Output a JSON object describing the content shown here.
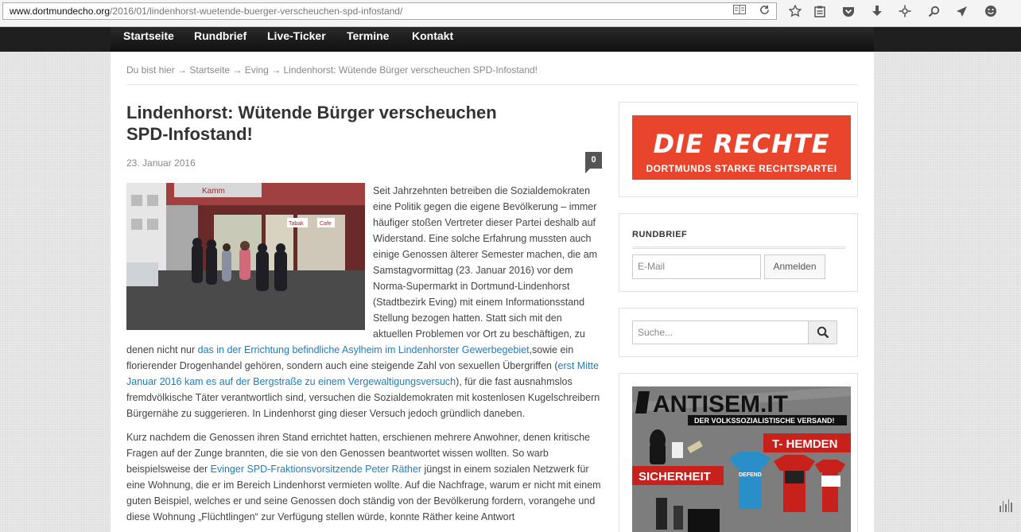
{
  "browser": {
    "url_domain": "www.dortmundecho.org",
    "url_path": "/2016/01/lindenhorst-wuetende-buerger-verscheuchen-spd-infostand/",
    "icons": [
      "reader-view-icon",
      "reload-icon",
      "bookmark-star-icon",
      "reading-list-icon",
      "pocket-icon",
      "download-icon",
      "extension-icon",
      "search-icon",
      "send-icon",
      "smiley-icon"
    ]
  },
  "nav": {
    "items": [
      "Startseite",
      "Rundbrief",
      "Live-Ticker",
      "Termine",
      "Kontakt"
    ]
  },
  "breadcrumb": {
    "prefix": "Du bist hier",
    "sep": "→",
    "items": [
      "Startseite",
      "Eving",
      "Lindenhorst: Wütende Bürger verscheuchen SPD-Infostand!"
    ]
  },
  "article": {
    "title": "Lindenhorst: Wütende Bürger verscheuchen SPD-Infostand!",
    "date": "23. Januar 2016",
    "comments": "0",
    "p1_a": "Seit Jahrzehnten betreiben die Sozialdemokraten eine Politik gegen die eigene Bevölkerung – immer häufiger stoßen Vertreter dieser Partei deshalb auf Widerstand. Eine solche Erfahrung mussten auch einige Genossen älterer Semester machen, die am Samstagvormittag (23. Januar 2016) vor dem Norma-Supermarkt in Dortmund-Lindenhorst (Stadtbezirk Eving) mit einem Informationsstand Stellung bezogen hatten. Statt sich mit den aktuellen Problemen vor Ort zu beschäftigen, zu denen nicht nur ",
    "p1_link1": "das in der Errichtung befindliche Asylheim im Lindenhorster Gewerbegebiet",
    "p1_b": ",sowie ein florierender Drogenhandel gehören, sondern auch eine steigende Zahl von sexuellen Übergriffen (",
    "p1_link2": "erst Mitte Januar 2016 kam es auf der Bergstraße zu einem Vergewaltigungsversuch",
    "p1_c": "), für die fast ausnahmslos fremdvölkische Täter verantwortlich sind, versuchen die Sozialdemokraten mit kostenlosen Kugelschreibern Bürgernähe zu suggerieren. In Lindenhorst ging dieser Versuch jedoch gründlich daneben.",
    "p2_a": "Kurz nachdem die Genossen ihren Stand errichtet hatten, erschienen mehrere Anwohner, denen kritische Fragen auf der Zunge brannten, die sie von den Genossen beantwortet wissen wollten. So warb beispielsweise der ",
    "p2_link": "Evinger SPD-Fraktionsvorsitzende Peter Räther",
    "p2_b": " jüngst in einem sozialen Netzwerk für eine Wohnung, die er im Bereich Lindenhorst vermieten wollte. Auf die Nachfrage, warum er nicht mit einem guten Beispiel, welches er und seine Genossen doch ständig von der Bevölkerung fordern, vorangehe und diese Wohnung „Flüchtlingen“ zur Verfügung stellen würde, konnte Räther keine Antwort"
  },
  "photo": {
    "sign": "Kamm",
    "shop_signs": [
      "Tabak",
      "Cafe"
    ]
  },
  "sidebar": {
    "die_rechte": {
      "title": "DIE RECHTE",
      "subtitle": "DORTMUNDS STARKE RECHTSPARTEI"
    },
    "newsletter": {
      "heading": "RUNDBRIEF",
      "email_placeholder": "E-Mail",
      "submit": "Anmelden"
    },
    "search": {
      "placeholder": "Suche..."
    },
    "antisem": {
      "logo": "ANTISEM.IT",
      "tagline": "DER VOLKSSOZIALISTISCHE VERSAND!",
      "label_left": "SICHERHEIT",
      "label_right": "T- HEMDEN",
      "shirt_text": "DEFEND"
    }
  },
  "colors": {
    "nav_bg": "#1a1a1a",
    "link": "#1a7fc1",
    "brand_red": "#e8452c",
    "antisem_red": "#c8201b"
  }
}
